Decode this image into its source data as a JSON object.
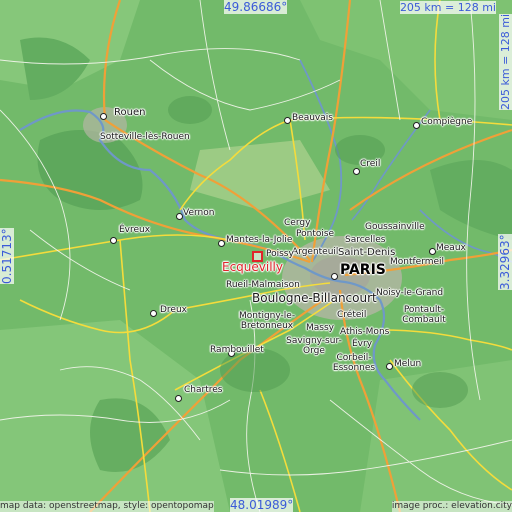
{
  "coords": {
    "north": "49.86686°",
    "south": "48.01989°",
    "west": "0.51713°",
    "east": "3.32963°"
  },
  "scale": {
    "horizontal": "205 km = 128 mi",
    "vertical": "205 km = 128 mi"
  },
  "credits": {
    "left": "map data: openstreetmap, style: opentopomap",
    "right": "image proc.: elevation.city"
  },
  "focus_place": "Ecquevilly",
  "places": {
    "rouen": "Rouen",
    "sotteville": "Sotteville-lès-Rouen",
    "beauvais": "Beauvais",
    "compiegne": "Compiègne",
    "creil": "Creil",
    "vernon": "Vernon",
    "evreux": "Évreux",
    "cergy": "Cergy",
    "pontoise": "Pontoise",
    "poissy": "Poissy",
    "mantes": "Mantes-la-Jolie",
    "argenteuil": "Argenteuil",
    "goussainville": "Goussainville",
    "sarcelles": "Sarcelles",
    "saint_denis": "Saint-Denis",
    "montfermeil": "Montfermeil",
    "meaux": "Meaux",
    "paris": "PARIS",
    "rueil": "Rueil-Malmaison",
    "boulogne": "Boulogne-Billancourt",
    "noisy": "Noisy-le-Grand",
    "dreux": "Dreux",
    "montigny": "Montigny-le-Bretonneux",
    "creteil": "Créteil",
    "massy": "Massy",
    "pontault": "Pontault-Combault",
    "savigny": "Savigny-sur-Orge",
    "athis": "Athis-Mons",
    "evry": "Évry",
    "rambouillet": "Rambouillet",
    "corbeil": "Corbeil-Essonnes",
    "melun": "Melun",
    "chartres": "Chartres"
  }
}
